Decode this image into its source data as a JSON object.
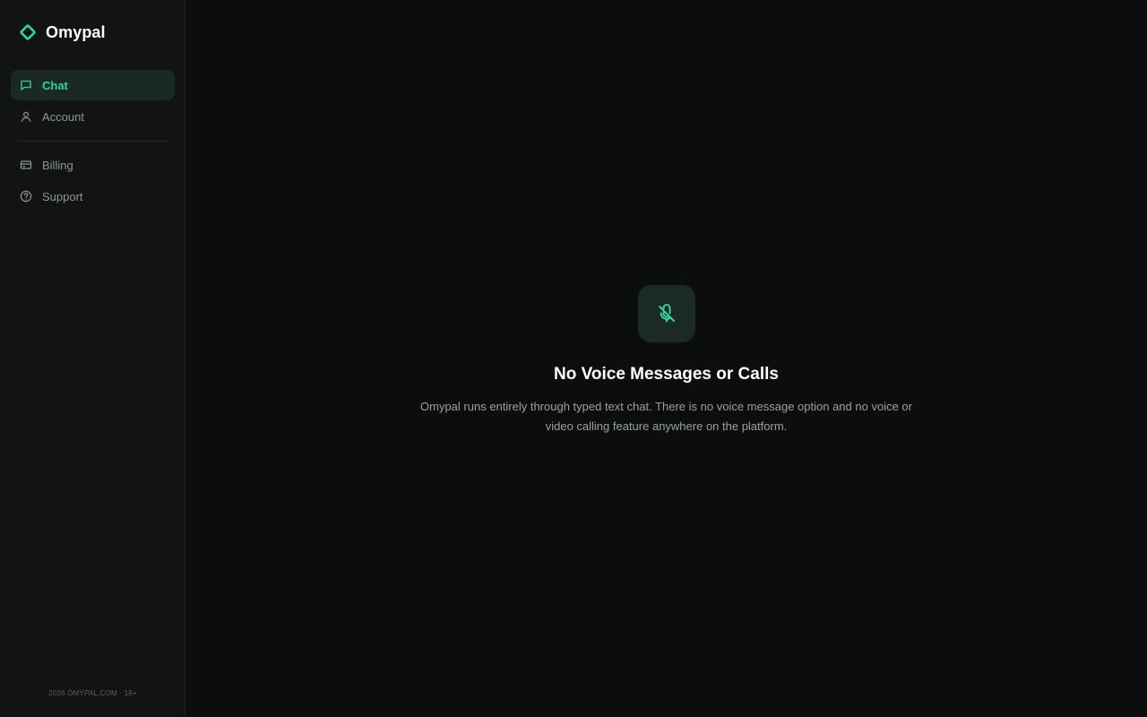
{
  "brand": {
    "name": "Omypal",
    "icon": "diamond-logo-icon",
    "accent_color": "#34d399"
  },
  "sidebar": {
    "items": [
      {
        "label": "Chat",
        "icon": "chat-bubble-icon",
        "active": true
      },
      {
        "label": "Account",
        "icon": "user-icon",
        "active": false
      },
      {
        "label": "Billing",
        "icon": "credit-card-icon",
        "active": false
      },
      {
        "label": "Support",
        "icon": "help-circle-icon",
        "active": false
      }
    ],
    "footer": "2026 OMYPAL.COM · 18+"
  },
  "main": {
    "empty_state": {
      "icon": "mic-off-icon",
      "title": "No Voice Messages or Calls",
      "description": "Omypal runs entirely through typed text chat. There is no voice message option and no voice or video calling feature anywhere on the platform."
    }
  },
  "colors": {
    "background": "#0c0e0d",
    "sidebar_background": "#111413",
    "active_item_background": "#1a2a23",
    "accent": "#34d399",
    "muted_text": "#8e9693"
  }
}
